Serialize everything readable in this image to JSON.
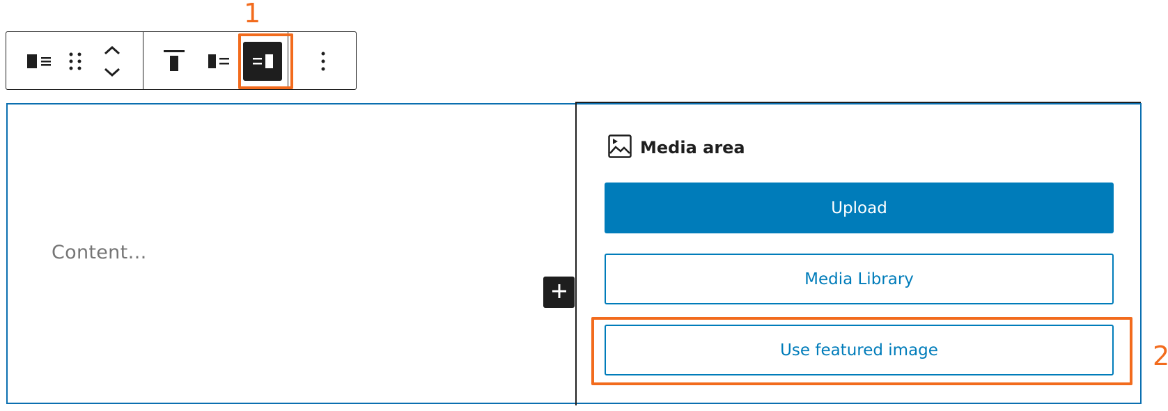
{
  "annotations": {
    "one": "1",
    "two": "2"
  },
  "toolbar": {
    "icons": [
      "media-text-icon",
      "drag-handle-icon",
      "move-up-down-icon",
      "align-top-icon",
      "media-left-icon",
      "media-right-icon",
      "more-options-icon"
    ],
    "active": "media-right-icon"
  },
  "content": {
    "placeholder": "Content…"
  },
  "media": {
    "title": "Media area",
    "upload_label": "Upload",
    "library_label": "Media Library",
    "featured_label": "Use featured image"
  },
  "colors": {
    "accent": "#007cba",
    "highlight": "#f26b1d",
    "dark": "#1e1e1e"
  }
}
